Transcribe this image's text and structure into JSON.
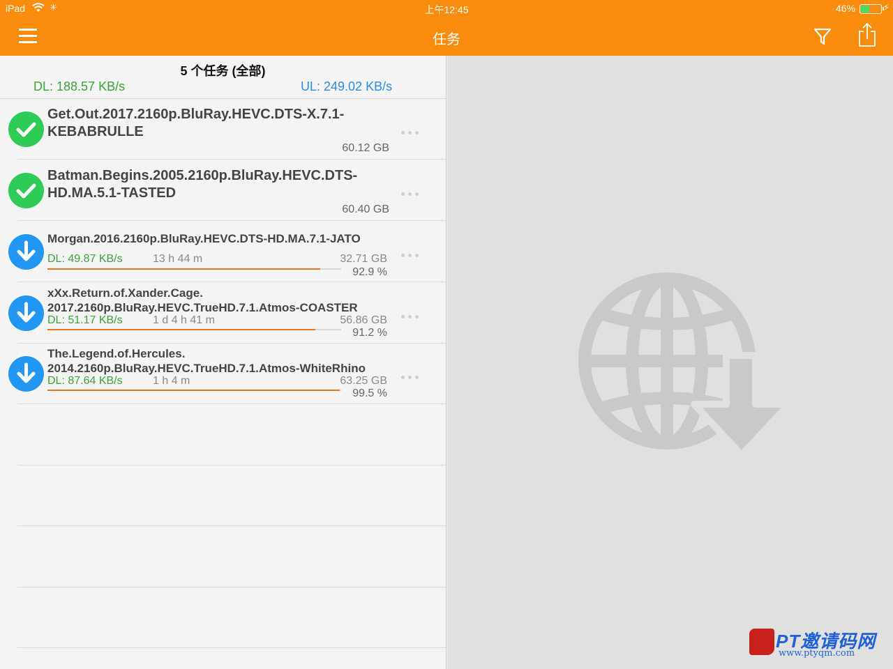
{
  "status_bar": {
    "carrier": "iPad",
    "time": "上午12:45",
    "battery": "46%",
    "battery_level": 0.46
  },
  "nav": {
    "title": "任务",
    "icons": [
      "menu-icon",
      "filter-icon",
      "share-icon"
    ]
  },
  "summary": {
    "count_label": "5 个任务 (全部)",
    "dl_speed": "DL: 188.57 KB/s",
    "ul_speed": "UL: 249.02 KB/s"
  },
  "tasks": [
    {
      "status": "completed",
      "name": "Get.Out.2017.2160p.BluRay.HEVC.DTS-X.7.1-KEBABRULLE",
      "name_line1": "Get.Out.2017.2160p.BluRay.HEVC.DTS-X.7.1-",
      "name_line2": "KEBABRULLE",
      "size": "60.12 GB"
    },
    {
      "status": "completed",
      "name": "Batman.Begins.2005.2160p.BluRay.HEVC.DTS-HD.MA.5.1-TASTED",
      "name_line1": "Batman.Begins.2005.2160p.BluRay.HEVC.DTS-",
      "name_line2": "HD.MA.5.1-TASTED",
      "size": "60.40 GB"
    },
    {
      "status": "downloading",
      "name_line1": "Morgan.2016.2160p.BluRay.HEVC.DTS-HD.MA.7.1-JATO",
      "name_line2": "",
      "speed": "DL: 49.87 KB/s",
      "eta": "13 h 44 m",
      "size": "32.71 GB",
      "progress": "92.9 %",
      "progress_value": 0.929
    },
    {
      "status": "downloading",
      "name_line1": "xXx.Return.of.Xander.Cage.",
      "name_line2": "2017.2160p.BluRay.HEVC.TrueHD.7.1.Atmos-COASTER",
      "speed": "DL: 51.17 KB/s",
      "eta": "1 d 4 h 41 m",
      "size": "56.86 GB",
      "progress": "91.2 %",
      "progress_value": 0.912
    },
    {
      "status": "downloading",
      "name_line1": "The.Legend.of.Hercules.",
      "name_line2": "2014.2160p.BluRay.HEVC.TrueHD.7.1.Atmos-WhiteRhino",
      "speed": "DL: 87.64 KB/s",
      "eta": "1 h 4 m",
      "size": "63.25 GB",
      "progress": "99.5 %",
      "progress_value": 0.995
    }
  ],
  "watermark": {
    "title": "PT邀请码网",
    "url": "www.ptyqm.com"
  },
  "colors": {
    "accent": "#f98c0c",
    "dl_green": "#3ca23a",
    "ul_blue": "#2a8ce6",
    "complete_green": "#2ecc57",
    "download_blue": "#2196f3",
    "progress_orange": "#f0721b"
  }
}
